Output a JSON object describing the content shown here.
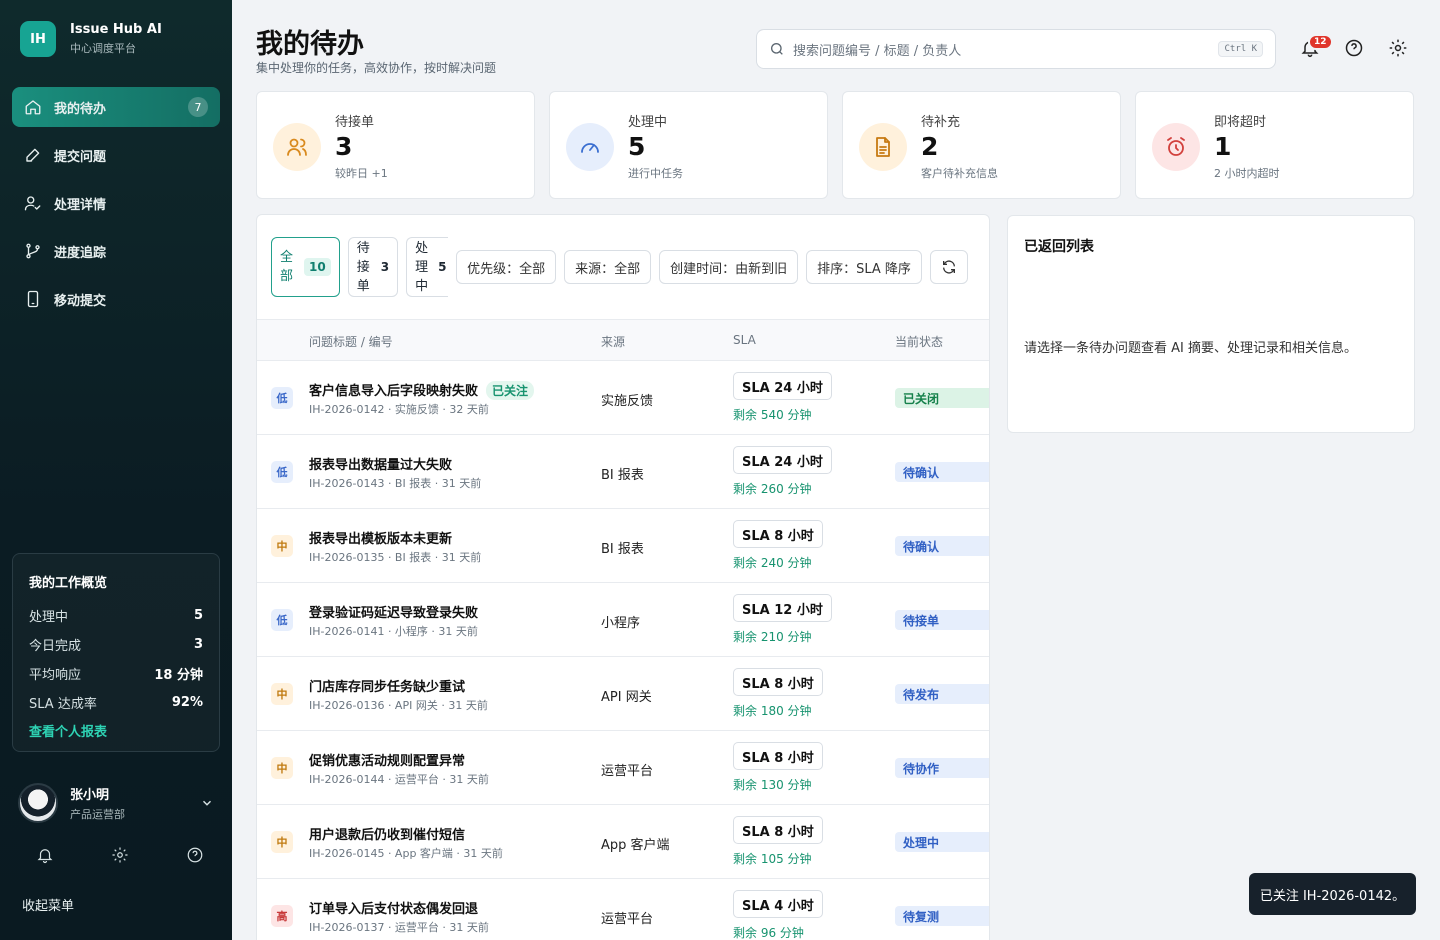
{
  "brand": {
    "logo": "IH",
    "name": "Issue Hub AI",
    "subtitle": "中心调度平台"
  },
  "nav": [
    {
      "label": "我的待办",
      "icon": "home-icon",
      "badge": "7",
      "active": true
    },
    {
      "label": "提交问题",
      "icon": "pen-icon"
    },
    {
      "label": "处理详情",
      "icon": "user-check-icon"
    },
    {
      "label": "进度追踪",
      "icon": "branch-icon"
    },
    {
      "label": "移动提交",
      "icon": "mobile-icon"
    }
  ],
  "overview": {
    "title": "我的工作概览",
    "rows": [
      {
        "label": "处理中",
        "value": "5"
      },
      {
        "label": "今日完成",
        "value": "3"
      },
      {
        "label": "平均响应",
        "value": "18 分钟"
      },
      {
        "label": "SLA 达成率",
        "value": "92%"
      }
    ],
    "link": "查看个人报表"
  },
  "user": {
    "name": "张小明",
    "dept": "产品运营部"
  },
  "sidebar_footer": {
    "collapse": "收起菜单"
  },
  "header": {
    "title": "我的待办",
    "subtitle": "集中处理你的任务，高效协作，按时解决问题",
    "search_placeholder": "搜索问题编号 / 标题 / 负责人",
    "shortcut": "Ctrl K",
    "notifications": "12"
  },
  "stats": [
    {
      "label": "待接单",
      "value": "3",
      "note": "较昨日 +1",
      "icon": "users-icon",
      "color": "#d98a1e",
      "bg": "#fff1dc"
    },
    {
      "label": "处理中",
      "value": "5",
      "note": "进行中任务",
      "icon": "gauge-icon",
      "color": "#3b6fd1",
      "bg": "#e6eefc"
    },
    {
      "label": "待补充",
      "value": "2",
      "note": "客户待补充信息",
      "icon": "document-icon",
      "color": "#c77a12",
      "bg": "#fff1dc"
    },
    {
      "label": "即将超时",
      "value": "1",
      "note": "2 小时内超时",
      "icon": "alarm-icon",
      "color": "#d2403c",
      "bg": "#fde5e5"
    }
  ],
  "filters": {
    "tabs": [
      {
        "label": "全部",
        "count": "10",
        "active": true
      },
      {
        "label": "待接单",
        "count": "3"
      },
      {
        "label": "处理中",
        "count": "5"
      }
    ],
    "priority": "优先级：全部",
    "source": "来源：全部",
    "created": "创建时间：由新到旧",
    "sort": "排序：SLA 降序"
  },
  "table": {
    "headers": {
      "title": "问题标题 / 编号",
      "source": "来源",
      "sla": "SLA",
      "status": "当前状态"
    },
    "rows": [
      {
        "prio": "低",
        "title": "客户信息导入后字段映射失败",
        "follow": "已关注",
        "meta": "IH-2026-0142 · 实施反馈 · 32 天前",
        "source": "实施反馈",
        "sla": "SLA 24 小时",
        "remain": "剩余 540 分钟",
        "status": "已关闭"
      },
      {
        "prio": "低",
        "title": "报表导出数据量过大失败",
        "meta": "IH-2026-0143 · BI 报表 · 31 天前",
        "source": "BI 报表",
        "sla": "SLA 24 小时",
        "remain": "剩余 260 分钟",
        "status": "待确认"
      },
      {
        "prio": "中",
        "title": "报表导出模板版本未更新",
        "meta": "IH-2026-0135 · BI 报表 · 31 天前",
        "source": "BI 报表",
        "sla": "SLA 8 小时",
        "remain": "剩余 240 分钟",
        "status": "待确认"
      },
      {
        "prio": "低",
        "title": "登录验证码延迟导致登录失败",
        "meta": "IH-2026-0141 · 小程序 · 31 天前",
        "source": "小程序",
        "sla": "SLA 12 小时",
        "remain": "剩余 210 分钟",
        "status": "待接单"
      },
      {
        "prio": "中",
        "title": "门店库存同步任务缺少重试",
        "meta": "IH-2026-0136 · API 网关 · 31 天前",
        "source": "API 网关",
        "sla": "SLA 8 小时",
        "remain": "剩余 180 分钟",
        "status": "待发布"
      },
      {
        "prio": "中",
        "title": "促销优惠活动规则配置异常",
        "meta": "IH-2026-0144 · 运营平台 · 31 天前",
        "source": "运营平台",
        "sla": "SLA 8 小时",
        "remain": "剩余 130 分钟",
        "status": "待协作"
      },
      {
        "prio": "中",
        "title": "用户退款后仍收到催付短信",
        "meta": "IH-2026-0145 · App 客户端 · 31 天前",
        "source": "App 客户端",
        "sla": "SLA 8 小时",
        "remain": "剩余 105 分钟",
        "status": "处理中"
      },
      {
        "prio": "高",
        "title": "订单导入后支付状态偶发回退",
        "meta": "IH-2026-0137 · 运营平台 · 31 天前",
        "source": "运营平台",
        "sla": "SLA 4 小时",
        "remain": "剩余 96 分钟",
        "status": "待复测"
      }
    ]
  },
  "detail": {
    "title": "已返回列表",
    "text": "请选择一条待办问题查看 AI 摘要、处理记录和相关信息。"
  },
  "toast": "已关注 IH-2026-0142。"
}
